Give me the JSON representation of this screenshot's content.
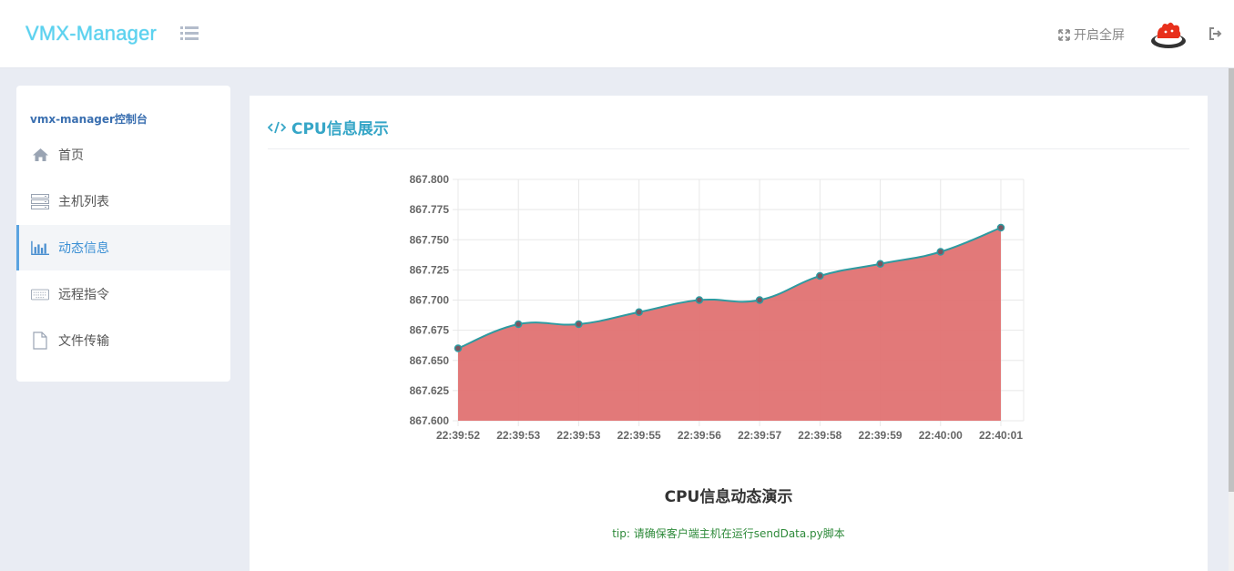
{
  "header": {
    "logo": "VMX-Manager",
    "fullscreen_label": "开启全屏"
  },
  "icons": {
    "menu_toggle": "list-icon",
    "fullscreen": "expand-icon",
    "logout": "sign-out-icon"
  },
  "sidebar": {
    "title": "vmx-manager控制台",
    "items": [
      {
        "label": "首页",
        "icon": "home-icon",
        "active": false
      },
      {
        "label": "主机列表",
        "icon": "server-icon",
        "active": false
      },
      {
        "label": "动态信息",
        "icon": "bar-chart-icon",
        "active": true
      },
      {
        "label": "远程指令",
        "icon": "keyboard-icon",
        "active": false
      },
      {
        "label": "文件传输",
        "icon": "file-icon",
        "active": false
      }
    ]
  },
  "main": {
    "title": "CPU信息展示",
    "caption": "CPU信息动态演示",
    "tip": "tip: 请确保客户端主机在运行sendData.py脚本"
  },
  "colors": {
    "accent": "#36a6c7",
    "fill": "#e07272",
    "line": "#2e9aa0",
    "tip": "#2e8a3a"
  },
  "chart_data": {
    "type": "area",
    "categories": [
      "22:39:52",
      "22:39:53",
      "22:39:53",
      "22:39:55",
      "22:39:56",
      "22:39:57",
      "22:39:58",
      "22:39:59",
      "22:40:00",
      "22:40:01"
    ],
    "values": [
      867.66,
      867.68,
      867.68,
      867.69,
      867.7,
      867.7,
      867.72,
      867.73,
      867.74,
      867.76
    ],
    "ylim": [
      867.6,
      867.8
    ],
    "yticks": [
      "867.800",
      "867.775",
      "867.750",
      "867.725",
      "867.700",
      "867.675",
      "867.650",
      "867.625",
      "867.600"
    ],
    "grid": true
  }
}
